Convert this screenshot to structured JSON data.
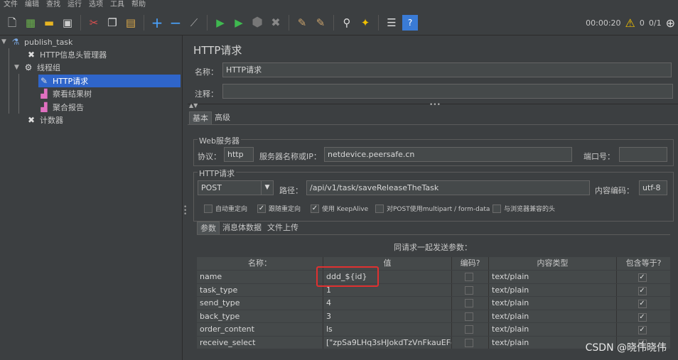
{
  "menu": [
    "文件",
    "编辑",
    "查找",
    "运行",
    "选项",
    "工具",
    "帮助"
  ],
  "toolbar": {
    "elapsed": "00:00:20",
    "warn_count": "0",
    "threads": "0/1"
  },
  "tree": {
    "root": "publish_task",
    "header_manager": "HTTP信息头管理器",
    "thread_group": "线程组",
    "http_request": "HTTP请求",
    "results_tree": "察看结果树",
    "aggregate": "聚合报告",
    "counter": "计数器"
  },
  "panel": {
    "title": "HTTP请求",
    "name_label": "名称：",
    "name_value": "HTTP请求",
    "comment_label": "注释：",
    "comment_value": "",
    "tabs": [
      "基本",
      "高级"
    ],
    "web_server_title": "Web服务器",
    "protocol_label": "协议：",
    "protocol_value": "http",
    "server_label": "服务器名称或IP：",
    "server_value": "netdevice.peersafe.cn",
    "port_label": "端口号：",
    "port_value": "",
    "http_group_title": "HTTP请求",
    "method_value": "POST",
    "path_label": "路径：",
    "path_value": "/api/v1/task/saveReleaseTheTask",
    "encoding_label": "内容编码：",
    "encoding_value": "utf-8",
    "checkboxes": [
      {
        "label": "自动重定向",
        "checked": false
      },
      {
        "label": "跟随重定向",
        "checked": true
      },
      {
        "label": "使用 KeepAlive",
        "checked": true
      },
      {
        "label": "对POST使用multipart / form-data",
        "checked": false
      },
      {
        "label": "与浏览器兼容的头",
        "checked": false
      }
    ],
    "param_tabs": [
      "参数",
      "消息体数据",
      "文件上传"
    ],
    "send_params_caption": "同请求一起发送参数："
  },
  "table": {
    "headers": [
      "名称：",
      "值",
      "编码?",
      "内容类型",
      "包含等于?"
    ],
    "rows": [
      {
        "name": "name",
        "value": "ddd_${id}",
        "encode": false,
        "type": "text/plain",
        "include": true
      },
      {
        "name": "task_type",
        "value": "1",
        "encode": false,
        "type": "text/plain",
        "include": true
      },
      {
        "name": "send_type",
        "value": "4",
        "encode": false,
        "type": "text/plain",
        "include": true
      },
      {
        "name": "back_type",
        "value": "3",
        "encode": false,
        "type": "text/plain",
        "include": true
      },
      {
        "name": "order_content",
        "value": "ls",
        "encode": false,
        "type": "text/plain",
        "include": true
      },
      {
        "name": "receive_select",
        "value": "[\"zpSa9LHq3sHJokdTzVnFkauEFq...",
        "encode": false,
        "type": "text/plain",
        "include": true
      }
    ]
  },
  "watermark": "CSDN @晓伟晓伟",
  "colors": {
    "selection": "#2f65ca",
    "highlight": "#e03030",
    "background": "#3c3f41"
  }
}
